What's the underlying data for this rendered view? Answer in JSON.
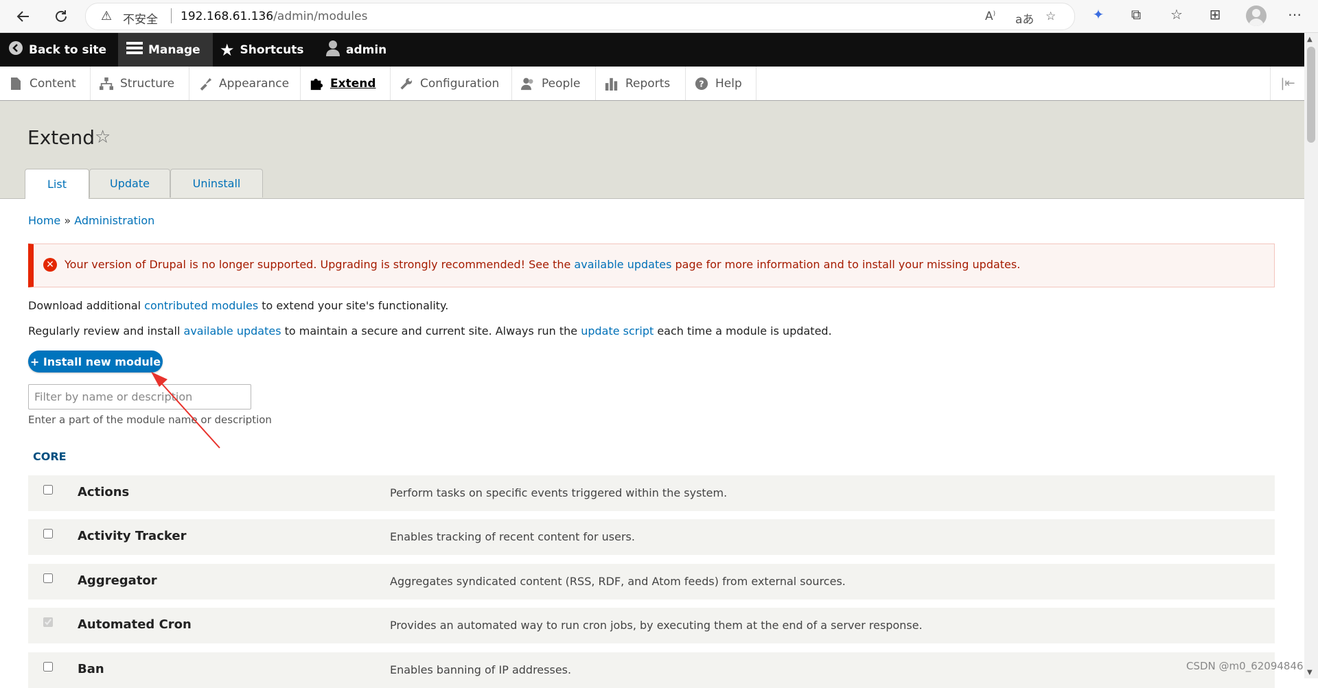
{
  "browser": {
    "insecure_label": "不安全",
    "url_host": "192.168.61.136",
    "url_path": "/admin/modules"
  },
  "toolbar": {
    "back_to_site": "Back to site",
    "manage": "Manage",
    "shortcuts": "Shortcuts",
    "user": "admin"
  },
  "tray": {
    "items": [
      {
        "label": "Content"
      },
      {
        "label": "Structure"
      },
      {
        "label": "Appearance"
      },
      {
        "label": "Extend"
      },
      {
        "label": "Configuration"
      },
      {
        "label": "People"
      },
      {
        "label": "Reports"
      },
      {
        "label": "Help"
      }
    ]
  },
  "page": {
    "title": "Extend",
    "tabs": [
      "List",
      "Update",
      "Uninstall"
    ]
  },
  "breadcrumb": {
    "home": "Home",
    "separator": "»",
    "administration": "Administration"
  },
  "alert": {
    "text_before": "Your version of Drupal is no longer supported. Upgrading is strongly recommended! See the ",
    "link": "available updates",
    "text_after": " page for more information and to install your missing updates.",
    "color": "#e62600"
  },
  "intro": {
    "line1_before": "Download additional ",
    "line1_link": "contributed modules",
    "line1_after": " to extend your site's functionality.",
    "line2_before": "Regularly review and install ",
    "line2_link1": "available updates",
    "line2_middle": " to maintain a secure and current site. Always run the ",
    "line2_link2": "update script",
    "line2_after": " each time a module is updated."
  },
  "install_button": "+ Install new module",
  "filter": {
    "placeholder": "Filter by name or description",
    "description": "Enter a part of the module name or description"
  },
  "section": "CORE",
  "modules": [
    {
      "name": "Actions",
      "description": "Perform tasks on specific events triggered within the system.",
      "checked": false,
      "disabled": false
    },
    {
      "name": "Activity Tracker",
      "description": "Enables tracking of recent content for users.",
      "checked": false,
      "disabled": false
    },
    {
      "name": "Aggregator",
      "description": "Aggregates syndicated content (RSS, RDF, and Atom feeds) from external sources.",
      "checked": false,
      "disabled": false
    },
    {
      "name": "Automated Cron",
      "description": "Provides an automated way to run cron jobs, by executing them at the end of a server response.",
      "checked": true,
      "disabled": true
    },
    {
      "name": "Ban",
      "description": "Enables banning of IP addresses.",
      "checked": false,
      "disabled": false
    }
  ],
  "watermark": "CSDN @m0_62094846",
  "colors": {
    "link": "#0071b8",
    "button": "#0074bd",
    "annotation_arrow": "#e8332d"
  }
}
